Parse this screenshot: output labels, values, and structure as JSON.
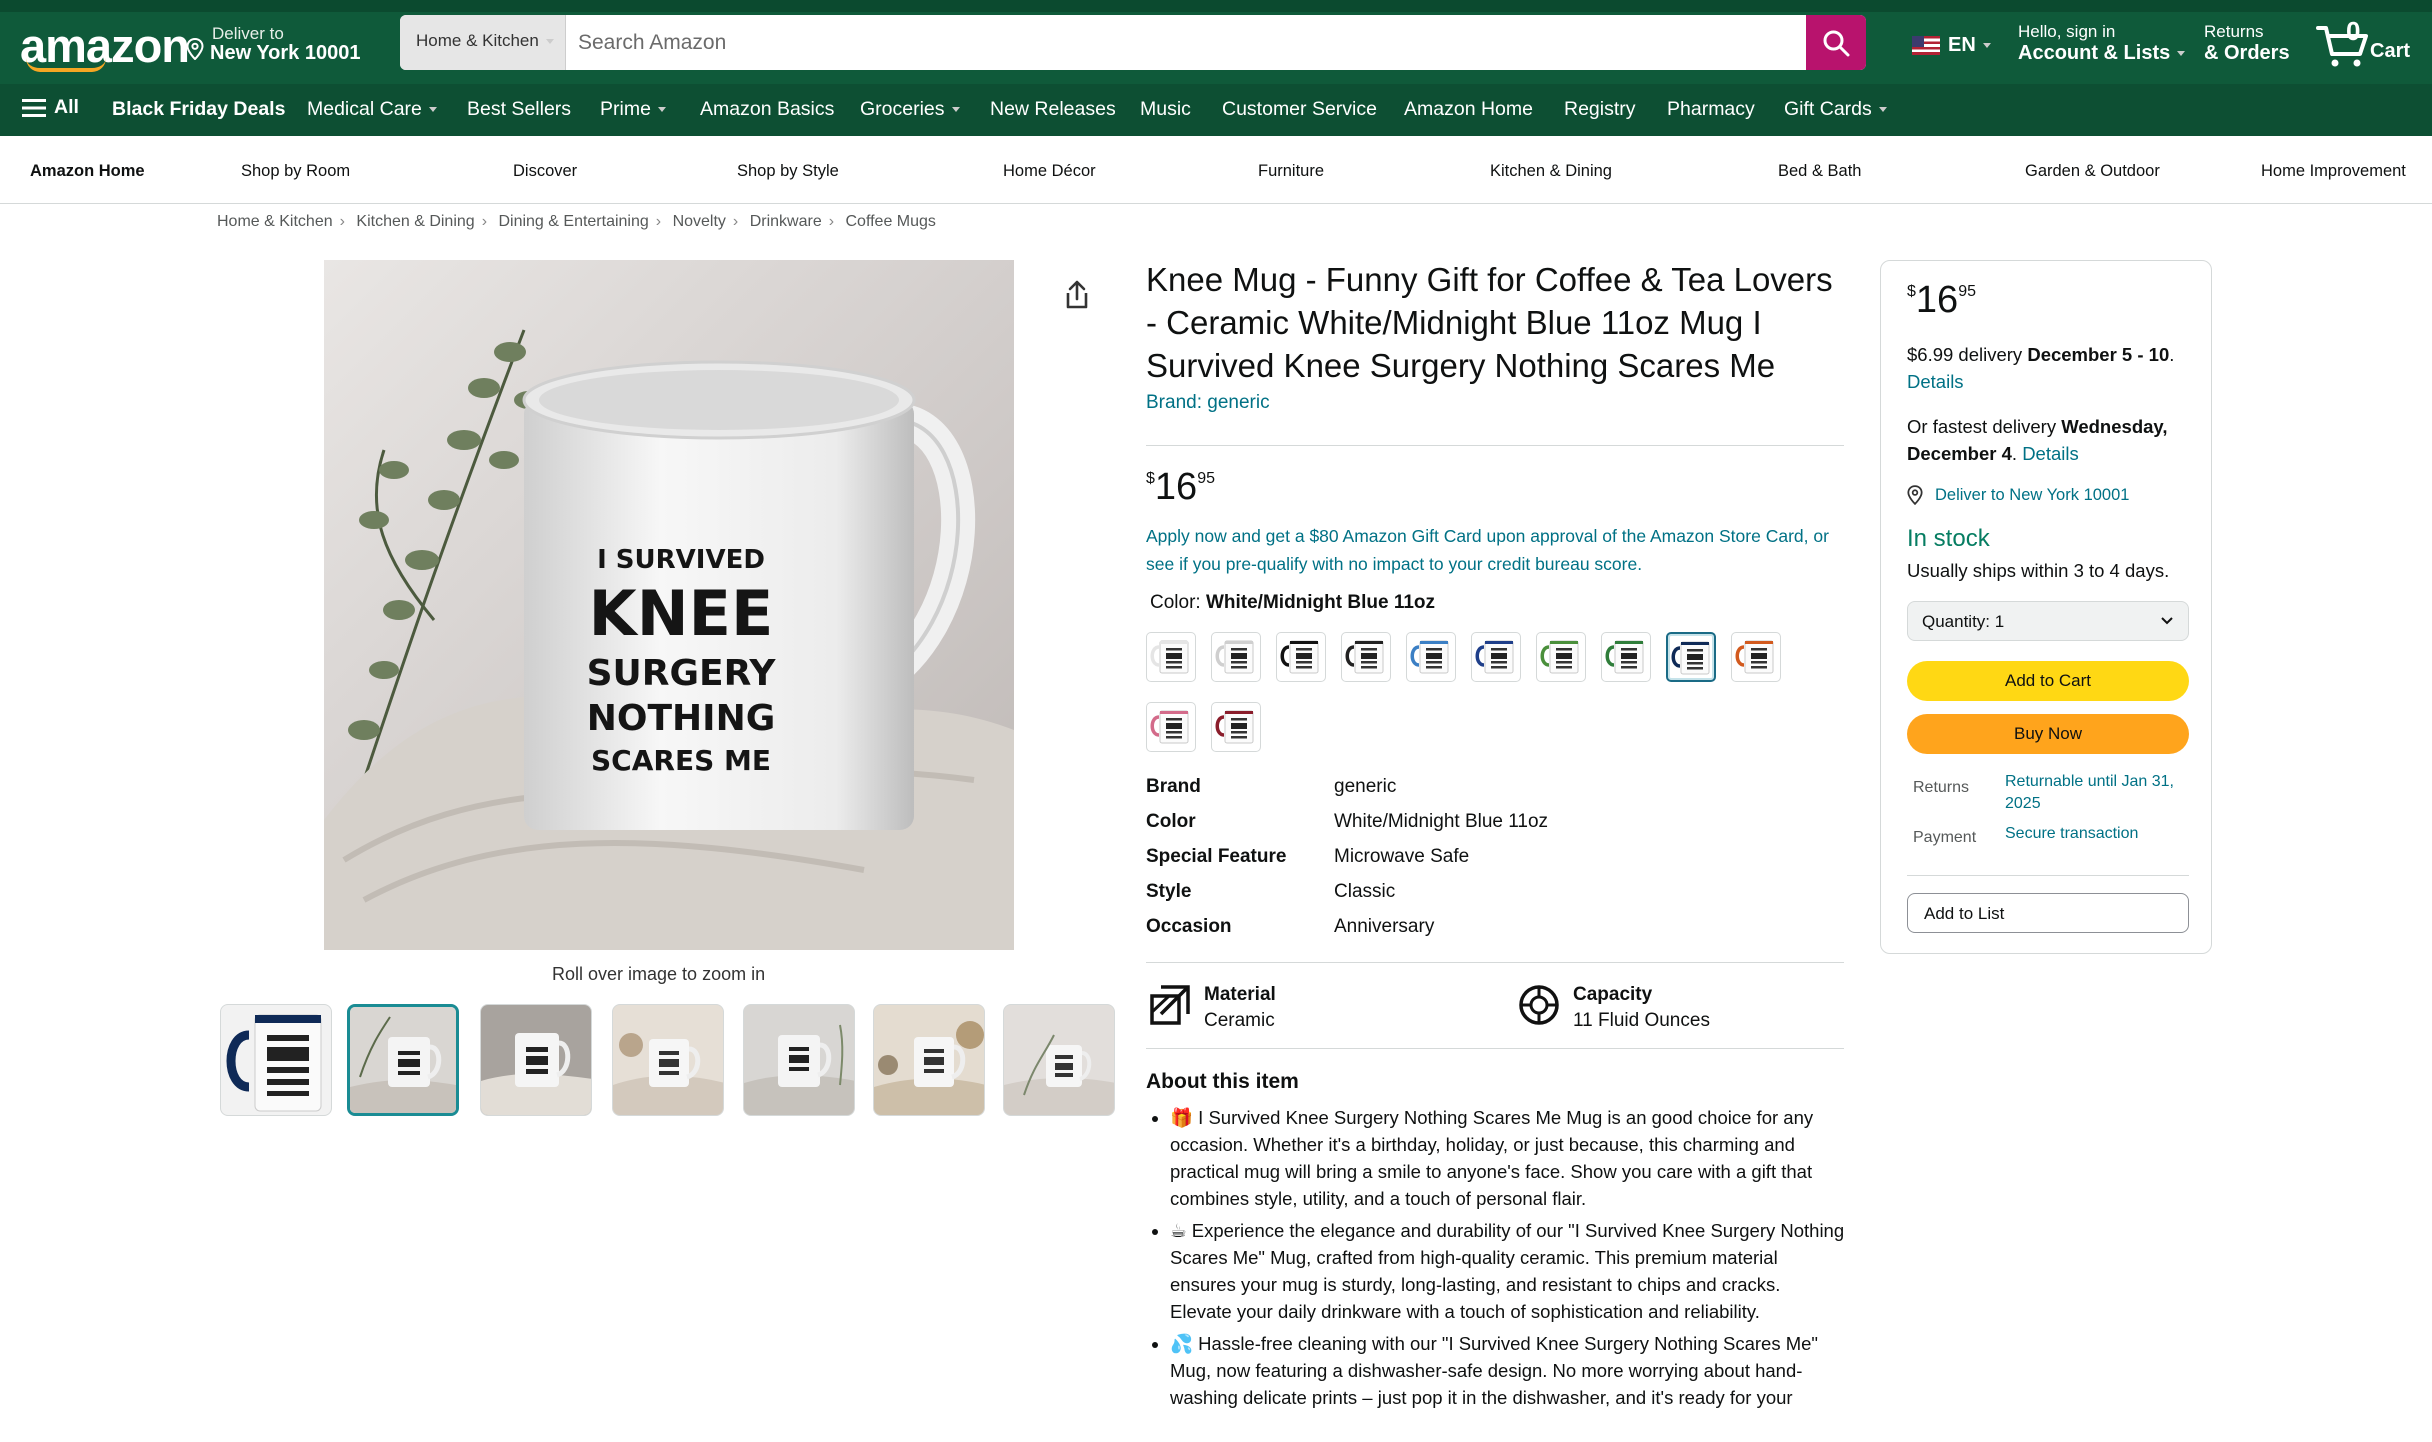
{
  "header": {
    "logo": "amazon",
    "deliver_line1": "Deliver to",
    "deliver_line2": "New York 10001",
    "search_category": "Home & Kitchen",
    "search_placeholder": "Search Amazon",
    "language": "EN",
    "account_line1": "Hello, sign in",
    "account_line2": "Account & Lists",
    "orders_line1": "Returns",
    "orders_line2": "& Orders",
    "cart_count": "0",
    "cart_label": "Cart",
    "colors": {
      "header_bg": "#0f5a3a",
      "nav_bg": "#0d4f33",
      "search_button": "#b8136d"
    }
  },
  "nav": {
    "all": "All",
    "items": [
      "Black Friday Deals",
      "Medical Care",
      "Best Sellers",
      "Prime",
      "Amazon Basics",
      "Groceries",
      "New Releases",
      "Music",
      "Customer Service",
      "Amazon Home",
      "Registry",
      "Pharmacy",
      "Gift Cards"
    ]
  },
  "subnav": [
    "Amazon Home",
    "Shop by Room",
    "Discover",
    "Shop by Style",
    "Home Décor",
    "Furniture",
    "Kitchen & Dining",
    "Bed & Bath",
    "Garden & Outdoor",
    "Home Improvement"
  ],
  "breadcrumb": [
    "Home & Kitchen",
    "Kitchen & Dining",
    "Dining & Entertaining",
    "Novelty",
    "Drinkware",
    "Coffee Mugs"
  ],
  "gallery": {
    "mug_text": [
      "I SURVIVED",
      "KNEE",
      "SURGERY",
      "NOTHING",
      "SCARES ME"
    ],
    "zoom_hint": "Roll over image to zoom in"
  },
  "product": {
    "title": "Knee Mug - Funny Gift for Coffee & Tea Lovers - Ceramic White/Midnight Blue 11oz Mug I Survived Knee Surgery Nothing Scares Me",
    "brand_link": "Brand: generic",
    "price_symbol": "$",
    "price_whole": "16",
    "price_fraction": "95",
    "promo": "Apply now and get a $80 Amazon Gift Card upon approval of the Amazon Store Card, or see if you pre-qualify with no impact to your credit bureau score.",
    "color_label": "Color:",
    "color_value": "White/Midnight Blue 11oz",
    "swatch_colors": [
      "#e5e5e5",
      "#cfcfcf",
      "#111111",
      "#222222",
      "#3b7fc4",
      "#1f3f8a",
      "#4a8f3b",
      "#2f7d3a",
      "#0f2a57",
      "#d25a1e",
      "#d36b8a",
      "#8a1d2b"
    ],
    "specs": [
      {
        "k": "Brand",
        "v": "generic"
      },
      {
        "k": "Color",
        "v": "White/Midnight Blue 11oz"
      },
      {
        "k": "Special Feature",
        "v": "Microwave Safe"
      },
      {
        "k": "Style",
        "v": "Classic"
      },
      {
        "k": "Occasion",
        "v": "Anniversary"
      }
    ],
    "features": [
      {
        "k": "Material",
        "v": "Ceramic"
      },
      {
        "k": "Capacity",
        "v": "11 Fluid Ounces"
      }
    ],
    "about_heading": "About this item",
    "bullets": [
      "🎁 I Survived Knee Surgery Nothing Scares Me Mug is an good choice for any occasion. Whether it's a birthday, holiday, or just because, this charming and practical mug will bring a smile to anyone's face. Show you care with a gift that combines style, utility, and a touch of personal flair.",
      "☕ Experience the elegance and durability of our \"I Survived Knee Surgery Nothing Scares Me\" Mug, crafted from high-quality ceramic. This premium material ensures your mug is sturdy, long-lasting, and resistant to chips and cracks. Elevate your daily drinkware with a touch of sophistication and reliability.",
      "💦 Hassle-free cleaning with our \"I Survived Knee Surgery Nothing Scares Me\" Mug, now featuring a dishwasher-safe design. No more worrying about hand-washing delicate prints – just pop it in the dishwasher, and it's ready for your"
    ]
  },
  "buybox": {
    "price_symbol": "$",
    "price_whole": "16",
    "price_fraction": "95",
    "delivery_prefix": "$6.99 delivery ",
    "delivery_date": "December 5 - 10",
    "delivery_suffix": ".",
    "details_link": "Details",
    "fastest_prefix": "Or fastest delivery ",
    "fastest_date": "Wednesday, December 4",
    "fastest_suffix": ". ",
    "deliver_to": "Deliver to New York 10001",
    "stock": "In stock",
    "ships": "Usually ships within 3 to 4 days.",
    "quantity": "Quantity:  1",
    "add_to_cart": "Add to Cart",
    "buy_now": "Buy Now",
    "returns_label": "Returns",
    "returns_value": "Returnable until Jan 31, 2025",
    "payment_label": "Payment",
    "payment_value": "Secure transaction",
    "add_to_list": "Add to List",
    "colors": {
      "add_to_cart": "#ffd814",
      "buy_now": "#ffa41c",
      "in_stock": "#067d62"
    }
  }
}
